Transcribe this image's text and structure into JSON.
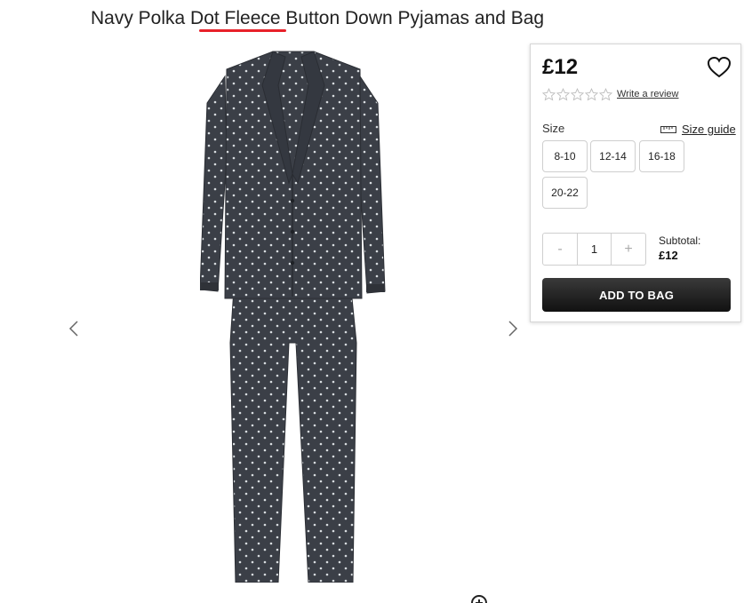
{
  "product": {
    "title": "Navy Polka Dot Fleece Button Down Pyjamas and Bag",
    "image_alt": "navy-polka-dot-pyjamas"
  },
  "gallery": {
    "prev_icon": "chevron-left-icon",
    "next_icon": "chevron-right-icon",
    "zoom_icon": "zoom-icon"
  },
  "panel": {
    "price": "£12",
    "wishlist_icon": "heart-icon",
    "rating": 0,
    "rating_max": 5,
    "review_link": "Write a review",
    "size_label": "Size",
    "size_guide_label": "Size guide",
    "sizes": [
      "8-10",
      "12-14",
      "16-18",
      "20-22"
    ],
    "quantity": {
      "minus": "-",
      "value": "1",
      "plus": "+"
    },
    "subtotal_label": "Subtotal:",
    "subtotal_value": "£12",
    "add_to_bag": "ADD TO BAG"
  },
  "colors": {
    "fabric": "#3b3f47",
    "dot": "#d8dde0",
    "button_dark": "#1a1a1a",
    "spell_underline": "#e8212a"
  }
}
